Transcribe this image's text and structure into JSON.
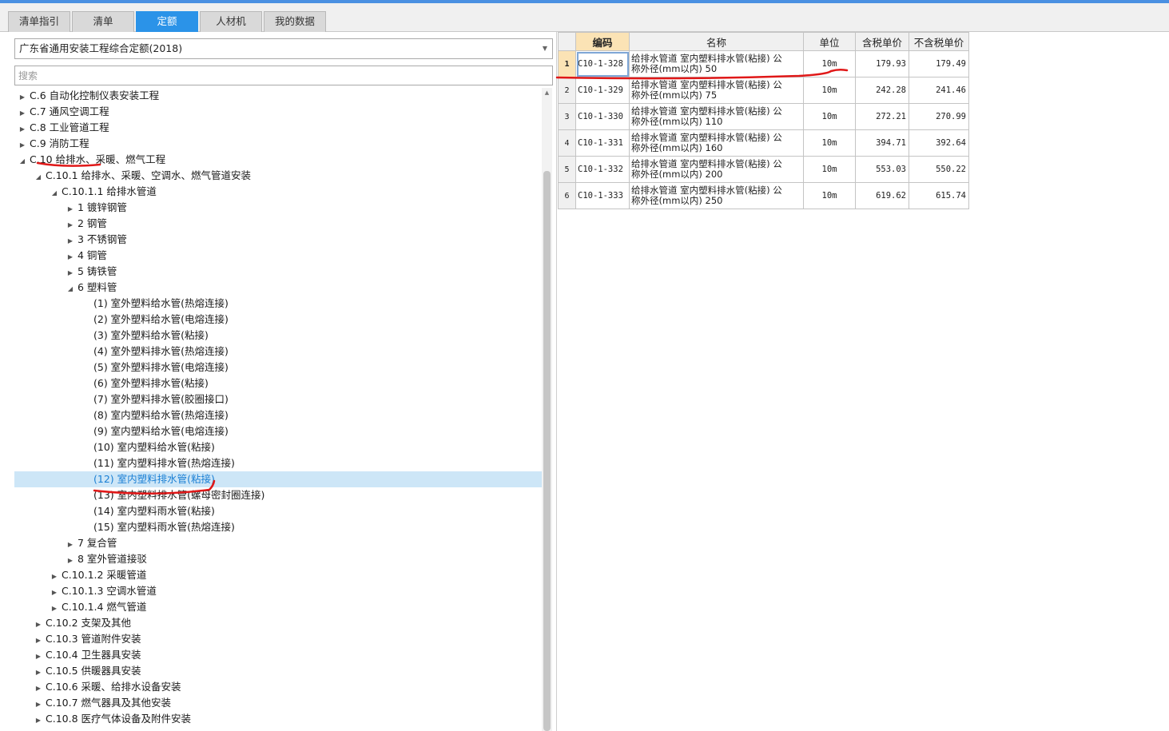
{
  "tabs": [
    {
      "label": "清单指引",
      "active": false
    },
    {
      "label": "清单",
      "active": false
    },
    {
      "label": "定额",
      "active": true
    },
    {
      "label": "人材机",
      "active": false
    },
    {
      "label": "我的数据",
      "active": false
    }
  ],
  "quota_library": {
    "selected": "广东省通用安装工程综合定额(2018)"
  },
  "search": {
    "placeholder": "搜索"
  },
  "tree": [
    {
      "label": "C.6 自动化控制仪表安装工程",
      "depth": 0,
      "state": "collapsed"
    },
    {
      "label": "C.7 通风空调工程",
      "depth": 0,
      "state": "collapsed"
    },
    {
      "label": "C.8 工业管道工程",
      "depth": 0,
      "state": "collapsed"
    },
    {
      "label": "C.9 消防工程",
      "depth": 0,
      "state": "collapsed"
    },
    {
      "label": "C.10 给排水、采暖、燃气工程",
      "depth": 0,
      "state": "expanded"
    },
    {
      "label": "C.10.1 给排水、采暖、空调水、燃气管道安装",
      "depth": 1,
      "state": "expanded"
    },
    {
      "label": "C.10.1.1 给排水管道",
      "depth": 2,
      "state": "expanded"
    },
    {
      "label": "1 镀锌钢管",
      "depth": 3,
      "state": "collapsed"
    },
    {
      "label": "2 钢管",
      "depth": 3,
      "state": "collapsed"
    },
    {
      "label": "3 不锈钢管",
      "depth": 3,
      "state": "collapsed"
    },
    {
      "label": "4 铜管",
      "depth": 3,
      "state": "collapsed"
    },
    {
      "label": "5 铸铁管",
      "depth": 3,
      "state": "collapsed"
    },
    {
      "label": "6 塑料管",
      "depth": 3,
      "state": "expanded"
    },
    {
      "label": "(1) 室外塑料给水管(热熔连接)",
      "depth": 4,
      "state": "leaf"
    },
    {
      "label": "(2) 室外塑料给水管(电熔连接)",
      "depth": 4,
      "state": "leaf"
    },
    {
      "label": "(3) 室外塑料给水管(粘接)",
      "depth": 4,
      "state": "leaf"
    },
    {
      "label": "(4) 室外塑料排水管(热熔连接)",
      "depth": 4,
      "state": "leaf"
    },
    {
      "label": "(5) 室外塑料排水管(电熔连接)",
      "depth": 4,
      "state": "leaf"
    },
    {
      "label": "(6) 室外塑料排水管(粘接)",
      "depth": 4,
      "state": "leaf"
    },
    {
      "label": "(7) 室外塑料排水管(胶圈接口)",
      "depth": 4,
      "state": "leaf"
    },
    {
      "label": "(8) 室内塑料给水管(热熔连接)",
      "depth": 4,
      "state": "leaf"
    },
    {
      "label": "(9) 室内塑料给水管(电熔连接)",
      "depth": 4,
      "state": "leaf"
    },
    {
      "label": "(10) 室内塑料给水管(粘接)",
      "depth": 4,
      "state": "leaf"
    },
    {
      "label": "(11) 室内塑料排水管(热熔连接)",
      "depth": 4,
      "state": "leaf"
    },
    {
      "label": "(12) 室内塑料排水管(粘接)",
      "depth": 4,
      "state": "leaf",
      "selected": true
    },
    {
      "label": "(13) 室内塑料排水管(螺母密封圈连接)",
      "depth": 4,
      "state": "leaf"
    },
    {
      "label": "(14) 室内塑料雨水管(粘接)",
      "depth": 4,
      "state": "leaf"
    },
    {
      "label": "(15) 室内塑料雨水管(热熔连接)",
      "depth": 4,
      "state": "leaf"
    },
    {
      "label": "7 复合管",
      "depth": 3,
      "state": "collapsed"
    },
    {
      "label": "8 室外管道接驳",
      "depth": 3,
      "state": "collapsed"
    },
    {
      "label": "C.10.1.2 采暖管道",
      "depth": 2,
      "state": "collapsed"
    },
    {
      "label": "C.10.1.3 空调水管道",
      "depth": 2,
      "state": "collapsed"
    },
    {
      "label": "C.10.1.4 燃气管道",
      "depth": 2,
      "state": "collapsed"
    },
    {
      "label": "C.10.2 支架及其他",
      "depth": 1,
      "state": "collapsed"
    },
    {
      "label": "C.10.3 管道附件安装",
      "depth": 1,
      "state": "collapsed"
    },
    {
      "label": "C.10.4 卫生器具安装",
      "depth": 1,
      "state": "collapsed"
    },
    {
      "label": "C.10.5 供暖器具安装",
      "depth": 1,
      "state": "collapsed"
    },
    {
      "label": "C.10.6 采暖、给排水设备安装",
      "depth": 1,
      "state": "collapsed"
    },
    {
      "label": "C.10.7 燃气器具及其他安装",
      "depth": 1,
      "state": "collapsed"
    },
    {
      "label": "C.10.8 医疗气体设备及附件安装",
      "depth": 1,
      "state": "collapsed"
    }
  ],
  "grid": {
    "headers": {
      "code": "编码",
      "name": "名称",
      "unit": "单位",
      "price_tax": "含税单价",
      "price_notax": "不含税单价"
    },
    "rows": [
      {
        "no": "1",
        "code": "C10-1-328",
        "name1": "给排水管道 室内塑料排水管(粘接) 公",
        "name2": "称外径(mm以内) 50",
        "unit": "10m",
        "price_tax": "179.93",
        "price_notax": "179.49"
      },
      {
        "no": "2",
        "code": "C10-1-329",
        "name1": "给排水管道 室内塑料排水管(粘接) 公",
        "name2": "称外径(mm以内) 75",
        "unit": "10m",
        "price_tax": "242.28",
        "price_notax": "241.46"
      },
      {
        "no": "3",
        "code": "C10-1-330",
        "name1": "给排水管道 室内塑料排水管(粘接) 公",
        "name2": "称外径(mm以内) 110",
        "unit": "10m",
        "price_tax": "272.21",
        "price_notax": "270.99"
      },
      {
        "no": "4",
        "code": "C10-1-331",
        "name1": "给排水管道 室内塑料排水管(粘接) 公",
        "name2": "称外径(mm以内) 160",
        "unit": "10m",
        "price_tax": "394.71",
        "price_notax": "392.64"
      },
      {
        "no": "5",
        "code": "C10-1-332",
        "name1": "给排水管道 室内塑料排水管(粘接) 公",
        "name2": "称外径(mm以内) 200",
        "unit": "10m",
        "price_tax": "553.03",
        "price_notax": "550.22"
      },
      {
        "no": "6",
        "code": "C10-1-333",
        "name1": "给排水管道 室内塑料排水管(粘接) 公",
        "name2": "称外径(mm以内) 250",
        "unit": "10m",
        "price_tax": "619.62",
        "price_notax": "615.74"
      }
    ]
  },
  "colors": {
    "accent": "#2b93e8",
    "selection": "#cde6f7",
    "header_highlight": "#fbe3b5",
    "annotation": "#e01818"
  }
}
